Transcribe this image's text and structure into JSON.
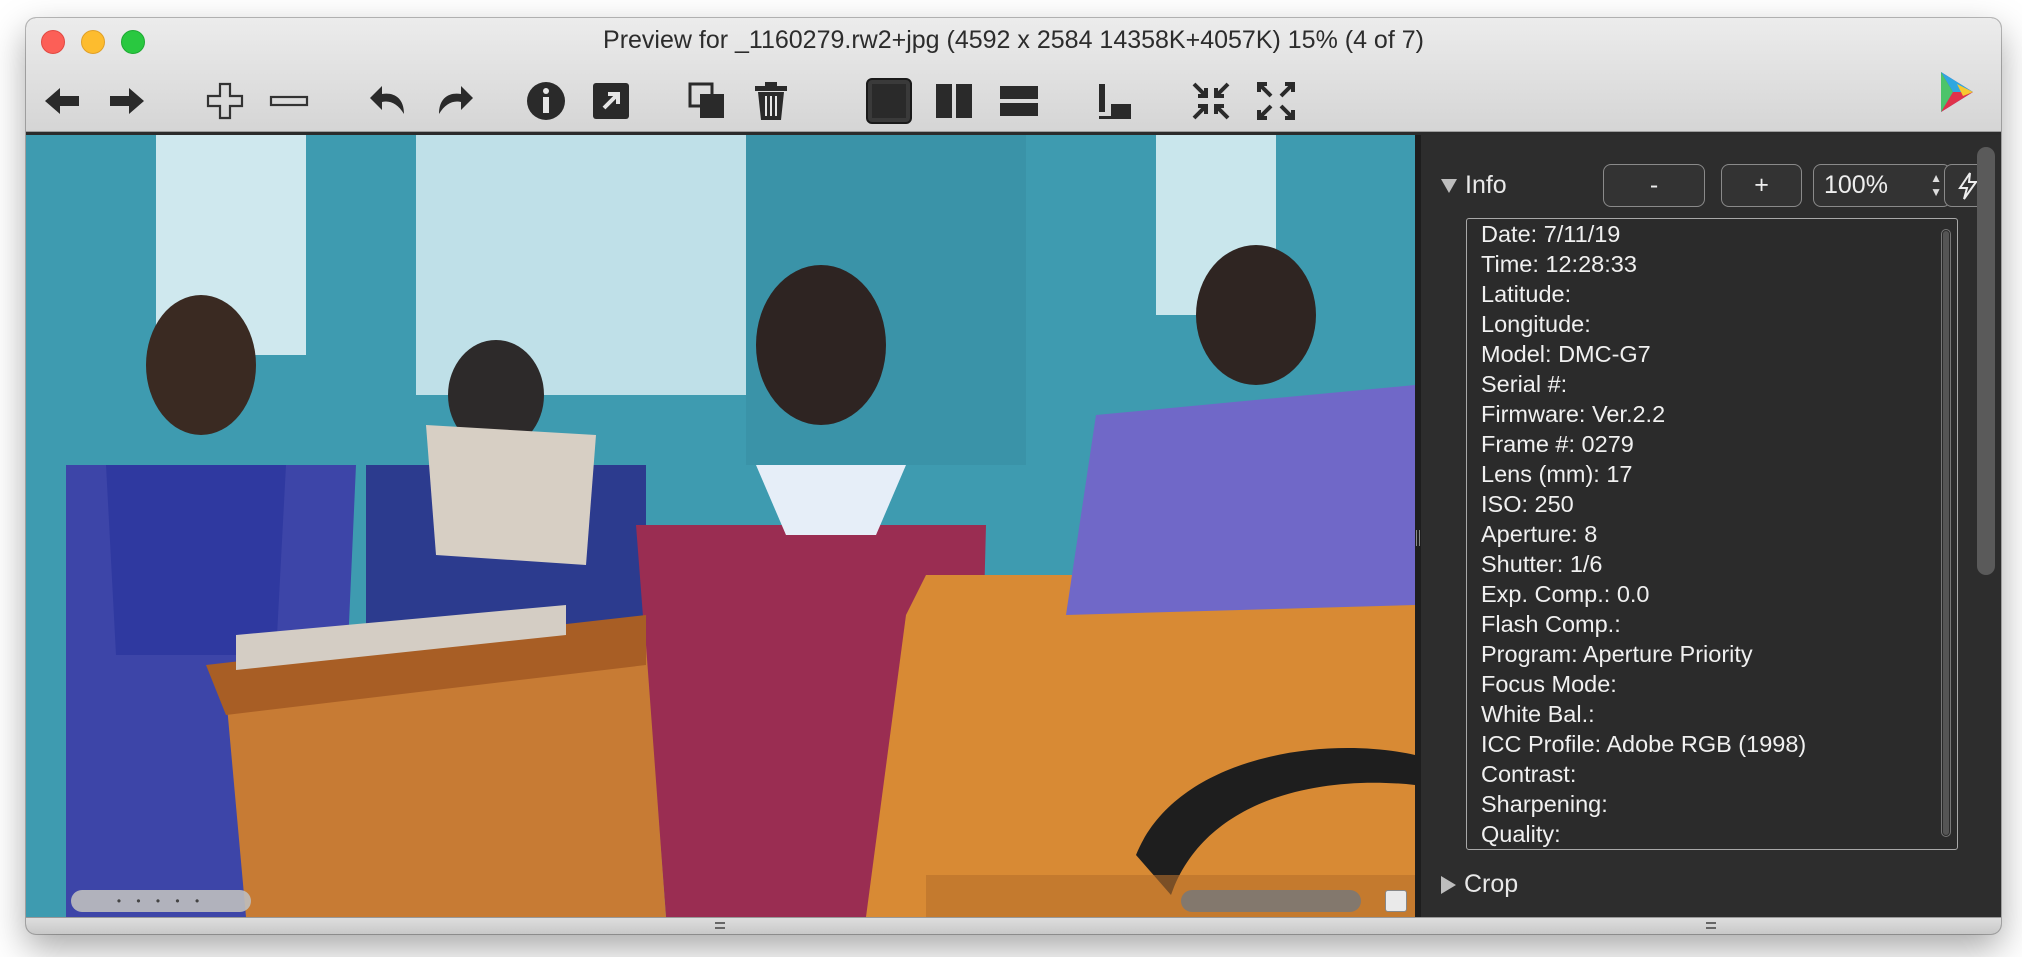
{
  "window": {
    "title": "Preview for _1160279.rw2+jpg (4592 x 2584 14358K+4057K) 15% (4 of 7)"
  },
  "toolbar": {
    "buttons": [
      {
        "name": "back-arrow-icon"
      },
      {
        "name": "forward-arrow-icon"
      },
      {
        "name": "zoom-in-icon"
      },
      {
        "name": "zoom-out-icon"
      },
      {
        "name": "rotate-left-icon"
      },
      {
        "name": "rotate-right-icon"
      },
      {
        "name": "info-icon"
      },
      {
        "name": "open-external-icon"
      },
      {
        "name": "copy-icon"
      },
      {
        "name": "trash-icon"
      },
      {
        "name": "single-view-icon",
        "selected": true
      },
      {
        "name": "split-vertical-icon"
      },
      {
        "name": "split-horizontal-icon"
      },
      {
        "name": "align-bottom-icon"
      },
      {
        "name": "collapse-icon"
      },
      {
        "name": "expand-icon"
      }
    ]
  },
  "inspector": {
    "info_section": {
      "label": "Info",
      "minus_label": "-",
      "plus_label": "+",
      "zoom_value": "100%"
    },
    "info_lines": [
      "Date: 7/11/19",
      "Time: 12:28:33",
      "Latitude:",
      "Longitude:",
      "Model: DMC-G7",
      "Serial #:",
      "Firmware: Ver.2.2",
      "Frame #: 0279",
      "Lens (mm): 17",
      "ISO: 250",
      "Aperture: 8",
      "Shutter: 1/6",
      "Exp. Comp.: 0.0",
      "Flash Comp.:",
      "Program: Aperture Priority",
      "Focus Mode:",
      "White Bal.:",
      "ICC Profile: Adobe RGB (1998)",
      "Contrast:",
      "Sharpening:",
      "Quality:"
    ],
    "crop_section": {
      "label": "Crop"
    }
  },
  "scroll": {
    "h_indicator": "• • • • •"
  },
  "colors": {
    "traffic_close": "#fc5f57",
    "traffic_min": "#fdbc2e",
    "traffic_max": "#29c840",
    "inspector_bg": "#2d2d2d"
  }
}
